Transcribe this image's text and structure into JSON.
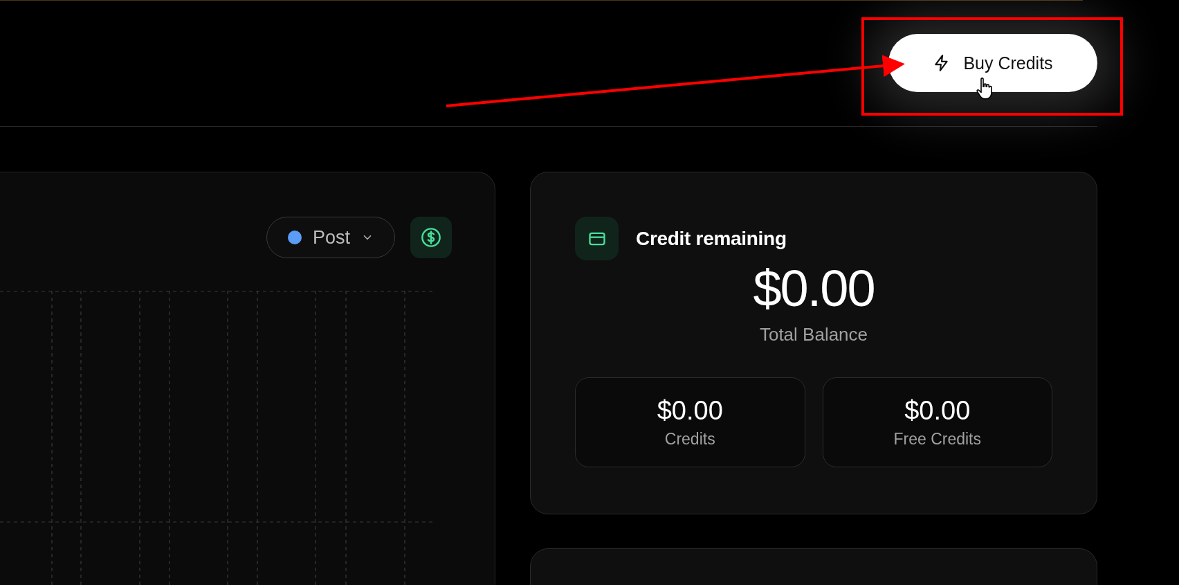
{
  "header": {
    "buy_button": {
      "label": "Buy Credits"
    }
  },
  "usage_card": {
    "filter": {
      "label": "Post"
    }
  },
  "credit_card": {
    "title": "Credit remaining",
    "total": {
      "value": "$0.00",
      "label": "Total Balance"
    },
    "breakdown": [
      {
        "value": "$0.00",
        "label": "Credits"
      },
      {
        "value": "$0.00",
        "label": "Free Credits"
      }
    ]
  }
}
